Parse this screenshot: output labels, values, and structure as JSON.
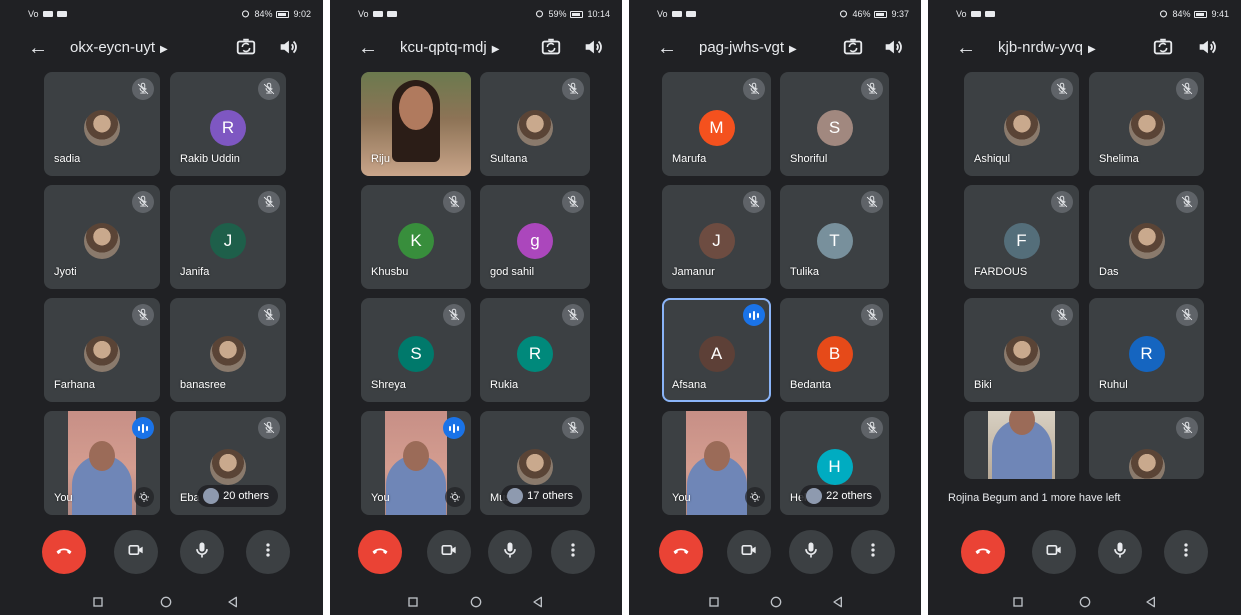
{
  "screens": [
    {
      "status": {
        "left_text": "Vo",
        "battery": "84%",
        "time": "9:02"
      },
      "meeting_code": "okx-eycn-uyt",
      "participants": [
        "sadia",
        "Rakib Uddin",
        "Jyoti",
        "Janifa",
        "Farhana",
        "banasree",
        "You",
        "Eba"
      ],
      "avatar_letters": [
        "",
        "R",
        "",
        "J",
        "",
        "",
        "",
        ""
      ],
      "others_label": "20 others"
    },
    {
      "status": {
        "left_text": "Vo",
        "battery": "59%",
        "time": "10:14"
      },
      "meeting_code": "kcu-qptq-mdj",
      "participants": [
        "Riju",
        "Sultana",
        "Khusbu",
        "god sahil",
        "Shreya",
        "Rukia",
        "You",
        "Mus"
      ],
      "avatar_letters": [
        "",
        "",
        "K",
        "g",
        "S",
        "R",
        "",
        ""
      ],
      "others_label": "17 others"
    },
    {
      "status": {
        "left_text": "Vo",
        "battery": "46%",
        "time": "9:37"
      },
      "meeting_code": "pag-jwhs-vgt",
      "participants": [
        "Marufa",
        "Shoriful",
        "Jamanur",
        "Tulika",
        "Afsana",
        "Bedanta",
        "You",
        "Hela"
      ],
      "avatar_letters": [
        "M",
        "S",
        "J",
        "T",
        "A",
        "B",
        "",
        "H"
      ],
      "others_label": "22 others"
    },
    {
      "status": {
        "left_text": "Vo",
        "battery": "84%",
        "time": "9:41"
      },
      "meeting_code": "kjb-nrdw-yvq",
      "participants": [
        "Ashiqul",
        "Shelima",
        "FARDOUS",
        "Das",
        "Biki",
        "Ruhul",
        "",
        ""
      ],
      "avatar_letters": [
        "",
        "",
        "F",
        "",
        "",
        "R",
        "",
        ""
      ],
      "notice": "Rojina Begum and 1 more have left"
    }
  ],
  "colors": {
    "background": "#202124",
    "tile": "#3c4043",
    "hangup": "#ea4335",
    "speaking": "#1a73e8",
    "active_outline": "#8ab4f8",
    "avatar_R": "#7e57c2",
    "avatar_J_green": "#1e5f4a",
    "avatar_K": "#388e3c",
    "avatar_g": "#ab47bc",
    "avatar_S_teal": "#00796b",
    "avatar_R_teal": "#00897b",
    "avatar_M": "#f4511e",
    "avatar_S_tan": "#a1887f",
    "avatar_J_brown": "#6d4c41",
    "avatar_T": "#78909c",
    "avatar_A": "#5d4037",
    "avatar_B": "#e64a19",
    "avatar_H": "#00acc1",
    "avatar_F": "#546e7a",
    "avatar_R_blue": "#1565c0"
  },
  "icons": {
    "back": "arrow-left-icon",
    "caret": "caret-right-icon",
    "camera_switch": "camera-switch-icon",
    "speaker": "speaker-icon",
    "mic_off": "mic-off-icon",
    "hangup": "call-end-icon",
    "video": "videocam-icon",
    "mic": "mic-icon",
    "more": "more-vert-icon",
    "nav_square": "recents-icon",
    "nav_circle": "home-icon",
    "nav_triangle": "back-nav-icon"
  }
}
